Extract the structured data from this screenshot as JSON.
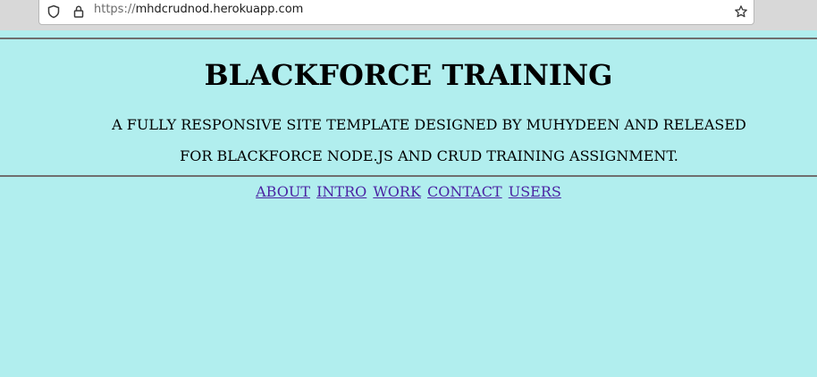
{
  "browser": {
    "url_scheme": "https://",
    "url_host": "mhdcrudnod.herokuapp.com"
  },
  "header": {
    "title": "BLACKFORCE TRAINING",
    "tagline": "A FULLY RESPONSIVE SITE TEMPLATE DESIGNED BY MUHYDEEN AND RELEASED FOR BLACKFORCE NODE.JS AND CRUD TRAINING ASSIGNMENT."
  },
  "nav": {
    "items": [
      {
        "label": "ABOUT"
      },
      {
        "label": "INTRO"
      },
      {
        "label": "WORK"
      },
      {
        "label": "CONTACT"
      },
      {
        "label": "USERS"
      }
    ]
  },
  "colors": {
    "page_background": "#b1eeee",
    "link": "#4a23a3",
    "rule": "#6f6f6f"
  }
}
